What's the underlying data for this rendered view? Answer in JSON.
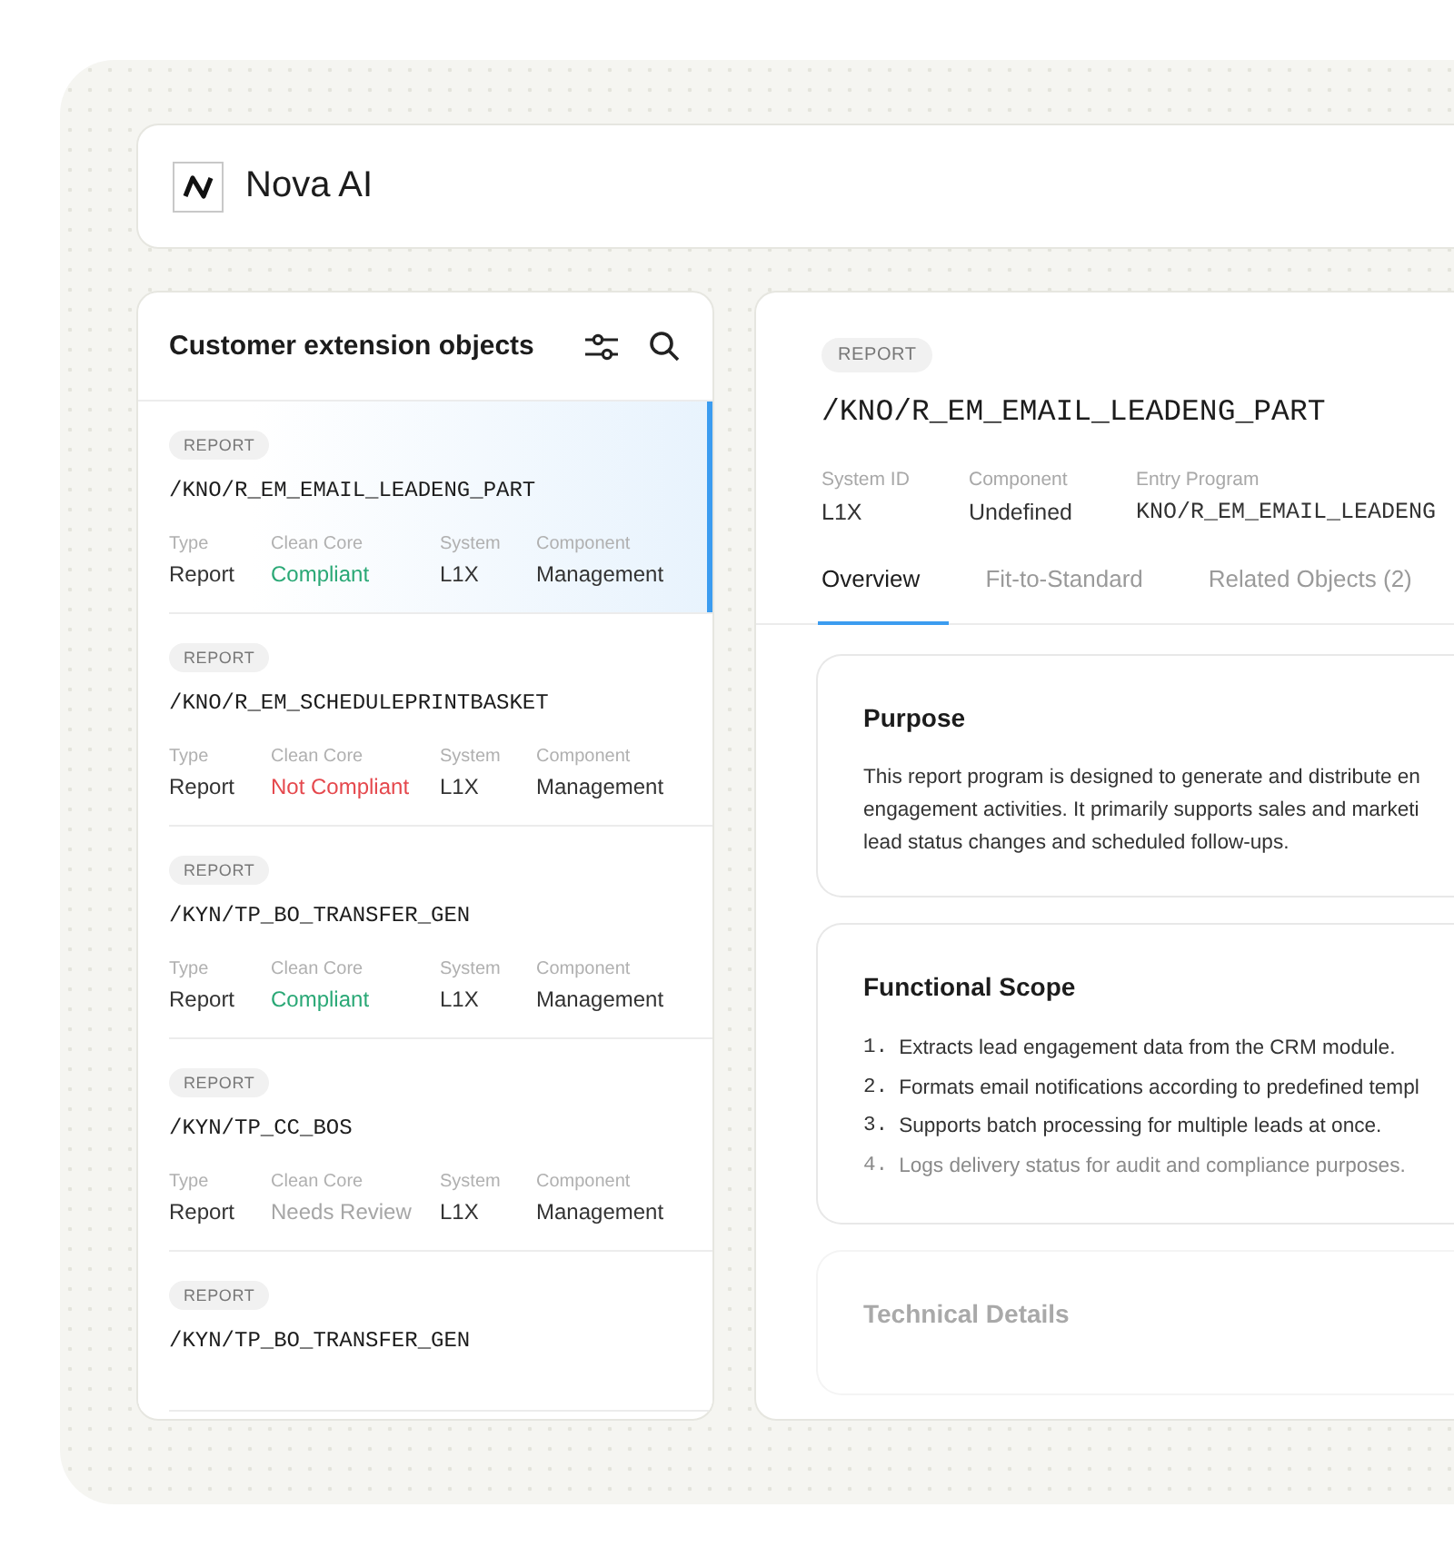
{
  "header": {
    "brand": "Nova AI"
  },
  "list_panel": {
    "title": "Customer extension objects",
    "items": [
      {
        "badge": "REPORT",
        "name": "/KNO/R_EM_EMAIL_LEADENG_PART",
        "selected": true,
        "meta": [
          {
            "label": "Type",
            "value": "Report"
          },
          {
            "label": "Clean Core",
            "value": "Compliant",
            "kind": "compliant"
          },
          {
            "label": "System",
            "value": "L1X"
          },
          {
            "label": "Component",
            "value": "Management"
          }
        ]
      },
      {
        "badge": "REPORT",
        "name": "/KNO/R_EM_SCHEDULEPRINTBASKET",
        "selected": false,
        "meta": [
          {
            "label": "Type",
            "value": "Report"
          },
          {
            "label": "Clean Core",
            "value": "Not Compliant",
            "kind": "not_compliant"
          },
          {
            "label": "System",
            "value": "L1X"
          },
          {
            "label": "Component",
            "value": "Management"
          }
        ]
      },
      {
        "badge": "REPORT",
        "name": "/KYN/TP_BO_TRANSFER_GEN",
        "selected": false,
        "meta": [
          {
            "label": "Type",
            "value": "Report"
          },
          {
            "label": "Clean Core",
            "value": "Compliant",
            "kind": "compliant"
          },
          {
            "label": "System",
            "value": "L1X"
          },
          {
            "label": "Component",
            "value": "Management"
          }
        ]
      },
      {
        "badge": "REPORT",
        "name": "/KYN/TP_CC_BOS",
        "selected": false,
        "meta": [
          {
            "label": "Type",
            "value": "Report"
          },
          {
            "label": "Clean Core",
            "value": "Needs Review",
            "kind": "review"
          },
          {
            "label": "System",
            "value": "L1X"
          },
          {
            "label": "Component",
            "value": "Management"
          }
        ]
      },
      {
        "badge": "REPORT",
        "name": "/KYN/TP_BO_TRANSFER_GEN",
        "selected": false
      }
    ]
  },
  "detail": {
    "badge": "REPORT",
    "title": "/KNO/R_EM_EMAIL_LEADENG_PART",
    "fields": [
      {
        "label": "System ID",
        "value": "L1X",
        "kind": "text"
      },
      {
        "label": "Component",
        "value": "Undefined",
        "kind": "text"
      },
      {
        "label": "Entry Program",
        "value": "KNO/R_EM_EMAIL_LEADENG",
        "kind": "code"
      }
    ],
    "tabs": [
      {
        "label": "Overview",
        "selected": true
      },
      {
        "label": "Fit-to-Standard",
        "selected": false
      },
      {
        "label": "Related Objects (2)",
        "selected": false
      }
    ],
    "sections": [
      {
        "title": "Purpose",
        "kind": "paragraph",
        "dimmed": false,
        "lines": [
          "This report program is designed to generate and distribute en",
          "engagement activities. It primarily supports sales and marketi",
          "lead status changes and scheduled follow-ups."
        ]
      },
      {
        "title": "Functional Scope",
        "kind": "list",
        "dimmed": false,
        "items": [
          {
            "number": "1.",
            "text": "Extracts lead engagement data from the CRM module.",
            "dimmed": false
          },
          {
            "number": "2.",
            "text": "Formats email notifications according to predefined templ",
            "dimmed": false
          },
          {
            "number": "3.",
            "text": "Supports batch processing for multiple leads at once.",
            "dimmed": false
          },
          {
            "number": "4.",
            "text": "Logs delivery status for audit and compliance purposes.",
            "dimmed": true
          }
        ]
      },
      {
        "title": "Technical Details",
        "kind": "paragraph",
        "dimmed": true
      }
    ]
  }
}
